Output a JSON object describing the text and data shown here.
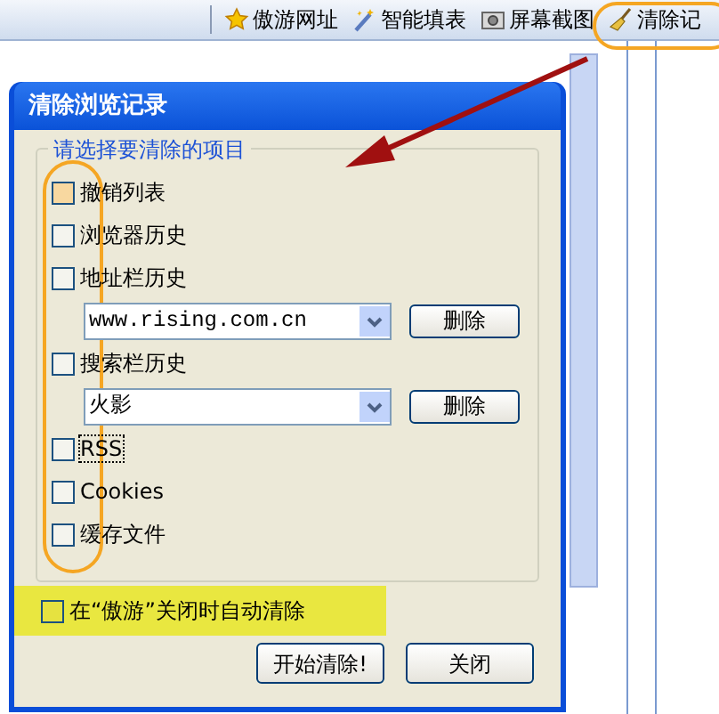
{
  "toolbar": {
    "items": [
      {
        "kind": "star",
        "label": "傲游网址"
      },
      {
        "kind": "wand",
        "label": "智能填表"
      },
      {
        "kind": "camera",
        "label": "屏幕截图"
      },
      {
        "kind": "broom",
        "label": "清除记"
      }
    ]
  },
  "dialog": {
    "title": "清除浏览记录",
    "group_title": "请选择要清除的项目",
    "items": [
      {
        "label": "撤销列表",
        "checked": false,
        "hovered": true,
        "focused": false
      },
      {
        "label": "浏览器历史",
        "checked": false,
        "hovered": false,
        "focused": false
      },
      {
        "label": "地址栏历史",
        "checked": false,
        "hovered": false,
        "focused": false,
        "history": {
          "value": "www.rising.com.cn",
          "button": "删除"
        }
      },
      {
        "label": "搜索栏历史",
        "checked": false,
        "hovered": false,
        "focused": false,
        "history": {
          "value": "火影",
          "button": "删除"
        }
      },
      {
        "label": "RSS",
        "checked": false,
        "hovered": false,
        "focused": true
      },
      {
        "label": "Cookies",
        "checked": false,
        "hovered": false,
        "focused": false
      },
      {
        "label": "缓存文件",
        "checked": false,
        "hovered": false,
        "focused": false
      }
    ],
    "auto_clear": {
      "label": "在“傲游”关闭时自动清除",
      "checked": false,
      "highlighted": true
    },
    "buttons": [
      "开始清除!",
      "关闭"
    ]
  }
}
